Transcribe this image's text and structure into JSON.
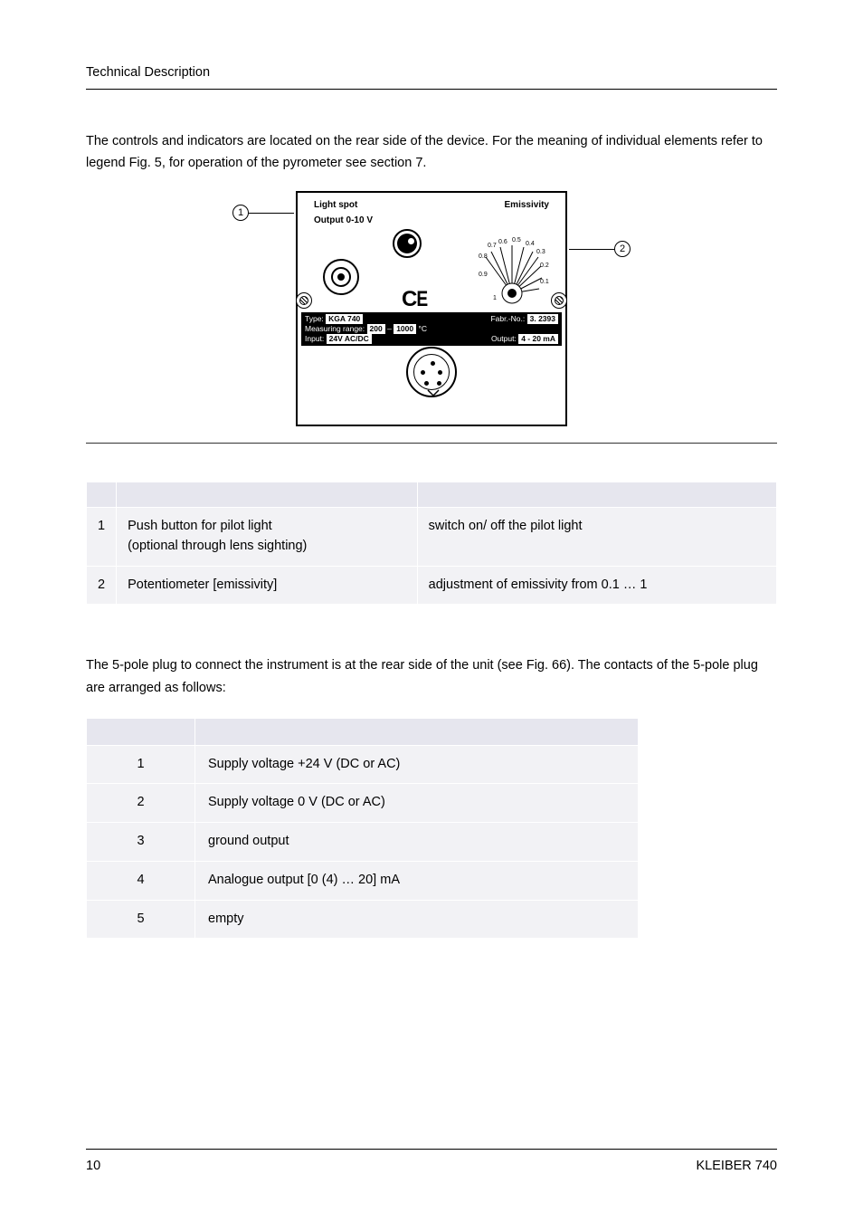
{
  "header": {
    "title": "Technical Description"
  },
  "intro": "The controls and indicators are located on the rear side of the device. For the meaning of individual elements refer to legend Fig. 5, for operation of the pyrometer see section 7.",
  "figure": {
    "callout1": "1",
    "callout2": "2",
    "labels": {
      "light_spot": "Light spot",
      "emissivity": "Emissivity",
      "output_0_10v": "Output  0-10 V"
    },
    "ticks": {
      "t01": "0.1",
      "t02": "0.2",
      "t03": "0.3",
      "t04": "0.4",
      "t05": "0.5",
      "t06": "0.6",
      "t07": "0.7",
      "t08": "0.8",
      "t09": "0.9",
      "t1": "1"
    },
    "ce": "CE",
    "band": {
      "type_label": "Type:",
      "type_value": "KGA 740",
      "fabr_label": "Fabr.-No.:",
      "fabr_value": "3. 2393",
      "range_label": "Measuring range:",
      "range_lo": "200",
      "range_dash": "–",
      "range_hi": "1000",
      "range_unit": "°C",
      "input_label": "Input:",
      "input_value": "24V AC/DC",
      "output_label": "Output:",
      "output_value": "4 - 20 mA"
    }
  },
  "legend": {
    "head_idx": "",
    "head_name": "",
    "head_func": "",
    "rows": [
      {
        "idx": "1",
        "name_line1": "Push button for pilot light",
        "name_line2": "(optional through lens sighting)",
        "func": "switch on/ off the pilot light"
      },
      {
        "idx": "2",
        "name_line1": "Potentiometer [emissivity]",
        "name_line2": "",
        "func": "adjustment of emissivity from 0.1 … 1"
      }
    ]
  },
  "plug_intro": "The 5-pole plug to connect the instrument is at the rear side of the unit (see Fig. 66). The contacts of the 5-pole plug are arranged as follows:",
  "pins": {
    "head_pin": "",
    "head_assign": "",
    "rows": [
      {
        "pin": "1",
        "assign": "Supply voltage +24 V (DC or AC)"
      },
      {
        "pin": "2",
        "assign": "Supply voltage 0 V (DC or AC)"
      },
      {
        "pin": "3",
        "assign": "ground output"
      },
      {
        "pin": "4",
        "assign": "Analogue output [0 (4) … 20] mA"
      },
      {
        "pin": "5",
        "assign": "empty"
      }
    ]
  },
  "footer": {
    "page": "10",
    "doc": "KLEIBER 740"
  }
}
